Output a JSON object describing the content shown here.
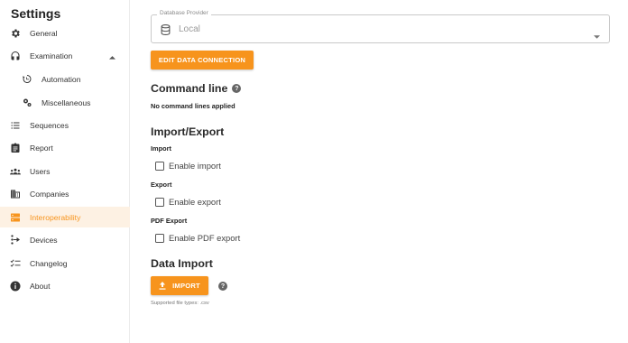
{
  "sidebar": {
    "title": "Settings",
    "items": [
      {
        "label": "General",
        "icon": "gear-icon"
      },
      {
        "label": "Examination",
        "icon": "headset-icon",
        "expanded": true
      },
      {
        "label": "Automation",
        "icon": "automation-icon"
      },
      {
        "label": "Miscellaneous",
        "icon": "cogs-icon"
      },
      {
        "label": "Sequences",
        "icon": "list-icon"
      },
      {
        "label": "Report",
        "icon": "clipboard-icon"
      },
      {
        "label": "Users",
        "icon": "users-icon"
      },
      {
        "label": "Companies",
        "icon": "building-icon"
      },
      {
        "label": "Interoperability",
        "icon": "server-icon",
        "active": true
      },
      {
        "label": "Devices",
        "icon": "devices-icon"
      },
      {
        "label": "Changelog",
        "icon": "checklist-icon"
      },
      {
        "label": "About",
        "icon": "info-icon"
      }
    ]
  },
  "database": {
    "legend": "Database Provider",
    "value": "Local"
  },
  "edit_button": "EDIT DATA CONNECTION",
  "command_line": {
    "heading": "Command line",
    "empty": "No command lines applied"
  },
  "import_export": {
    "heading": "Import/Export",
    "import_label": "Import",
    "import_checkbox": "Enable import",
    "export_label": "Export",
    "export_checkbox": "Enable export",
    "pdf_label": "PDF Export",
    "pdf_checkbox": "Enable PDF export"
  },
  "data_import": {
    "heading": "Data Import",
    "button": "IMPORT",
    "hint": "Supported file types: .csv"
  },
  "colors": {
    "accent": "#f7941d",
    "active_bg": "#fdf1e3"
  }
}
